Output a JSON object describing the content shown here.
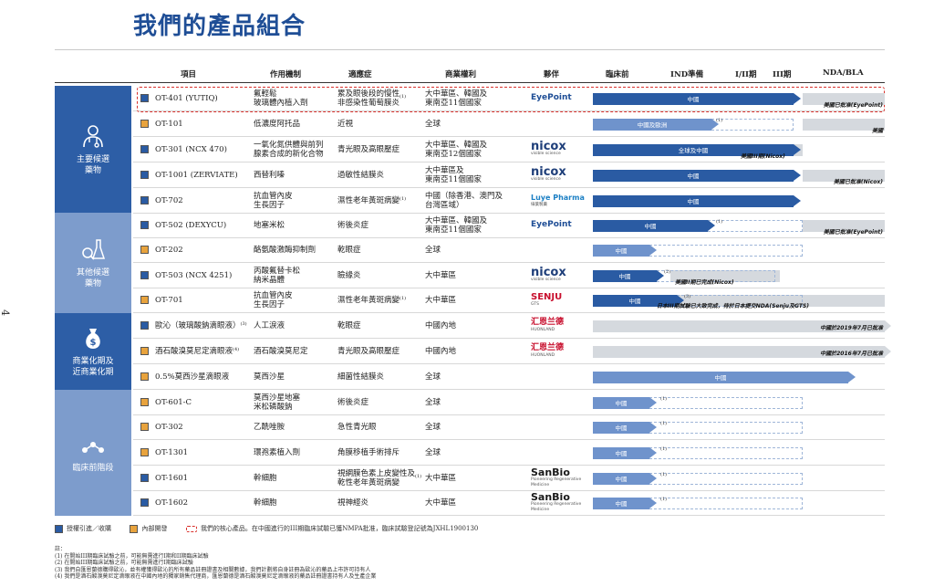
{
  "title": "我們的產品組合",
  "page_number": "4",
  "headers": {
    "project": "項目",
    "mechanism": "作用機制",
    "indication": "適應症",
    "rights": "商業權利",
    "partner": "夥伴",
    "preclinical": "臨床前",
    "ind": "IND準備",
    "phase12": "I/II期",
    "phase3": "III期",
    "nda": "NDA/BLA"
  },
  "categories": {
    "main": "主要候選\n藥物",
    "other": "其他候選\n藥物",
    "commercial": "商業化期及\n近商業化期",
    "preclinical": "臨床前階段"
  },
  "rows": [
    {
      "name": "OT-401 (YUTIQ)",
      "mech": "氟輕鬆\n玻璃體內植入劑",
      "ind": "累及眼後段的慢性\n非感染性葡萄膜炎",
      "ind_sup": "(1)",
      "rights": "大中華區、韓國及\n東南亞11個國家",
      "partner": "EyePoint",
      "bar_label": "中國",
      "note": "美國已批准(EyePoint)"
    },
    {
      "name": "OT-101",
      "mech": "低濃度阿托品",
      "ind": "近視",
      "rights": "全球",
      "partner": "",
      "bar_label": "中國及歐洲",
      "bar_sup": "(1)",
      "note": "美國"
    },
    {
      "name": "OT-301 (NCX 470)",
      "mech": "一氧化氮供體與前列\n腺素合成的新化合物",
      "ind": "青光眼及高眼壓症",
      "rights": "大中華區、韓國及\n東南亞12個國家",
      "partner": "nicox",
      "partner_sub": "visible science",
      "bar_label": "全球及中國",
      "note": "美國III期(Nicox)"
    },
    {
      "name": "OT-1001 (ZERVIATE)",
      "mech": "西替利嗪",
      "ind": "過敏性結膜炎",
      "rights": "大中華區及\n東南亞11個國家",
      "partner": "nicox",
      "partner_sub": "visible science",
      "bar_label": "中國",
      "note": "美國已批准(Nicox)"
    },
    {
      "name": "OT-702",
      "mech": "抗血管內皮\n生長因子",
      "ind": "濕性老年黃斑病變",
      "ind_sup": "(1)",
      "rights": "中國（除香港、澳門及\n台灣區域）",
      "partner": "Luye Pharma",
      "partner_sub": "綠葉製藥",
      "bar_label": "中國",
      "note": ""
    },
    {
      "name": "OT-502 (DEXYCU)",
      "mech": "地塞米松",
      "ind": "術後炎症",
      "rights": "大中華區、韓國及\n東南亞11個國家",
      "partner": "EyePoint",
      "bar_label": "中國",
      "bar_sup": "(1)",
      "note": "美國已批准(EyePoint)"
    },
    {
      "name": "OT-202",
      "mech": "酪氨酸激酶抑制劑",
      "ind": "乾眼症",
      "rights": "全球",
      "partner": "",
      "bar_label": "中國",
      "note": ""
    },
    {
      "name": "OT-503 (NCX 4251)",
      "mech": "丙酸氟替卡松\n納米晶體",
      "ind": "瞼緣炎",
      "rights": "大中華區",
      "partner": "nicox",
      "partner_sub": "visible science",
      "bar_label": "中國",
      "bar_sup": "(2)",
      "note": "美國II期已完成(Nicox)"
    },
    {
      "name": "OT-701",
      "mech": "抗血管內皮\n生長因子",
      "ind": "濕性老年黃斑病變",
      "ind_sup": "(1)",
      "rights": "大中華區",
      "partner": "SENJU",
      "partner_sub": "GTS",
      "bar_label": "中國",
      "bar_sup": "(3)",
      "note": "日本III期試驗已大致完成，待於日本提交NDA(Senju及GTS)"
    },
    {
      "name": "歐沁（玻璃酸鈉滴眼液）",
      "name_sup": "(3)",
      "mech": "人工淚液",
      "ind": "乾眼症",
      "rights": "中國內地",
      "partner": "汇恩兰德",
      "partner_sub": "HUONLAND",
      "bar_label": "",
      "note": "中國於2019年7月已批准"
    },
    {
      "name": "酒石酸溴莫尼定滴眼液",
      "name_sup": "(4)",
      "mech": "酒石酸溴莫尼定",
      "ind": "青光眼及高眼壓症",
      "rights": "中國內地",
      "partner": "汇恩兰德",
      "partner_sub": "HUONLAND",
      "bar_label": "",
      "note": "中國於2016年7月已批准"
    },
    {
      "name": "0.5%莫西沙星滴眼液",
      "mech": "莫西沙星",
      "ind": "細菌性結膜炎",
      "rights": "全球",
      "partner": "",
      "bar_label": "中國",
      "note": ""
    },
    {
      "name": "OT-601-C",
      "mech": "莫西沙星地塞\n米松磷酸鈉",
      "ind": "術後炎症",
      "rights": "全球",
      "partner": "",
      "bar_label": "中國",
      "bar_sup": "(1)",
      "note": ""
    },
    {
      "name": "OT-302",
      "mech": "乙酰唑胺",
      "ind": "急性青光眼",
      "rights": "全球",
      "partner": "",
      "bar_label": "中國",
      "bar_sup": "(1)",
      "note": ""
    },
    {
      "name": "OT-1301",
      "mech": "環孢素植入劑",
      "ind": "角膜移植手術排斥",
      "rights": "全球",
      "partner": "",
      "bar_label": "中國",
      "bar_sup": "(1)",
      "note": ""
    },
    {
      "name": "OT-1601",
      "mech": "幹細胞",
      "ind": "視網膜色素上皮變性及\n乾性老年黃斑病變",
      "ind_sup": "(1)",
      "rights": "大中華區",
      "partner": "SanBio",
      "partner_sub": "Pioneering Regenerative Medicine",
      "bar_label": "中國",
      "bar_sup": "(1)",
      "note": ""
    },
    {
      "name": "OT-1602",
      "mech": "幹細胞",
      "ind": "視神經炎",
      "rights": "大中華區",
      "partner": "SanBio",
      "partner_sub": "Pioneering Regenerative Medicine",
      "bar_label": "中國",
      "bar_sup": "(1)",
      "note": ""
    }
  ],
  "legend": {
    "licensed": "授權引進／收購",
    "inhouse": "內部開發",
    "core": "我們的核心產品。在中國進行的III期臨床試驗已獲NMPA批准，臨床試驗登記號為JXHL1900130"
  },
  "footnotes": [
    "註：",
    "(1) 在開始III期臨床試驗之前，可能無需進行I期和II期臨床試驗",
    "(2) 在開始III期臨床試驗之前，可能無需進行I期臨床試驗",
    "(3) 我們自匯恩蘭德購得歐沁，並有權獲得歐沁的所有藥品註冊證書及相關數據，我們計劃將自身註冊為歐沁的藥品上市許可持有人",
    "(4) 我們是酒石酸溴莫尼定滴眼液在中國內地的獨家銷售代理商，匯恩蘭德是酒石酸溴莫尼定滴眼液的藥品註冊證書持有人及生產企業"
  ],
  "colors": {
    "brand_blue": "#2a5ba3",
    "cat_blue1": "#2d5ea6",
    "cat_blue2": "#7d9ccc",
    "bar_light": "#6f93cc",
    "orange": "#e8a33d",
    "red": "#d9312c"
  }
}
